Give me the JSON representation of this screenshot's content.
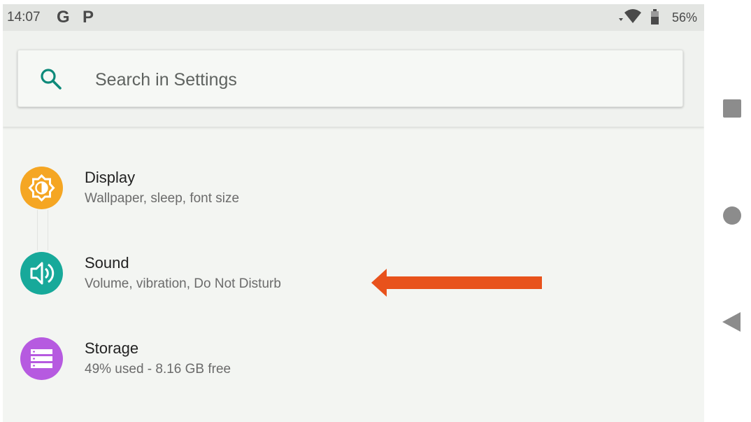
{
  "status_bar": {
    "time": "14:07",
    "notification_icons": [
      "G",
      "P"
    ],
    "battery": "56%"
  },
  "search": {
    "placeholder": "Search in Settings"
  },
  "settings_items": [
    {
      "title": "Display",
      "subtitle": "Wallpaper, sleep, font size",
      "icon": "display-icon",
      "color": "#f5a623"
    },
    {
      "title": "Sound",
      "subtitle": "Volume, vibration, Do Not Disturb",
      "icon": "sound-icon",
      "color": "#17a99a"
    },
    {
      "title": "Storage",
      "subtitle": "49% used - 8.16 GB free",
      "icon": "storage-icon",
      "color": "#b65ae0"
    }
  ],
  "annotation": {
    "arrow_color": "#e8521c",
    "points_to": "Sound"
  },
  "nav": {
    "buttons": [
      "recents",
      "home",
      "back"
    ]
  },
  "colors": {
    "accent": "#0e8a7a",
    "status_bar_bg": "#e3e5e2",
    "screen_bg": "#f3f5f2"
  }
}
